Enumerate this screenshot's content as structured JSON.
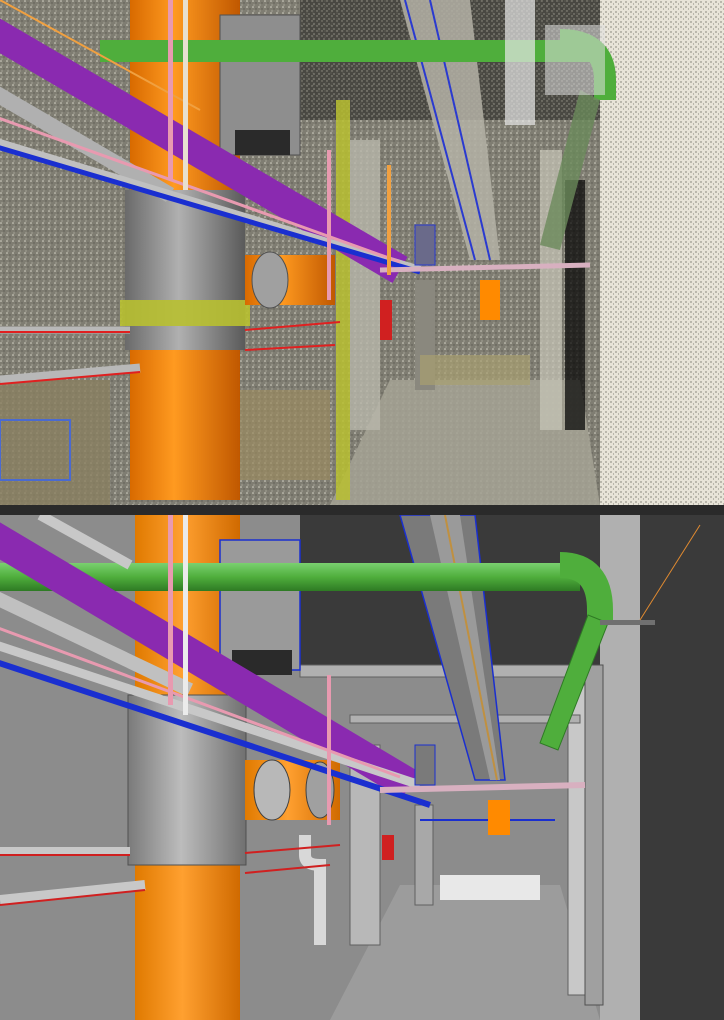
{
  "scene": {
    "top_view": "point-cloud",
    "bottom_view": "bim-model"
  },
  "colors": {
    "purple_pipe": "#8a2ab0",
    "orange_pipe": "#ff8a00",
    "green_pipe": "#4fae3c",
    "blue_pipe": "#1a2fd0",
    "pink_pipe": "#e89ab0",
    "red_pipe": "#d02020",
    "duct_gray": "#9a9a9a",
    "wall_dark": "#3a3a3a",
    "floor": "#9c9c9c",
    "yellow_green": "#b8c030"
  }
}
